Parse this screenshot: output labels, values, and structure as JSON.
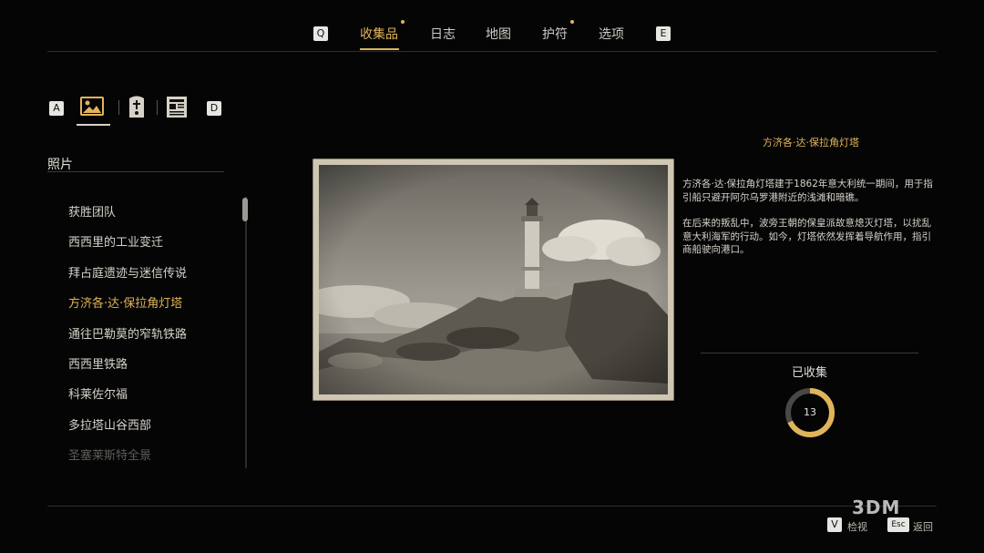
{
  "top_nav": {
    "key_left": "Q",
    "key_right": "E",
    "tabs": [
      {
        "label": "收集品",
        "active": true,
        "dot": true
      },
      {
        "label": "日志",
        "active": false,
        "dot": false
      },
      {
        "label": "地图",
        "active": false,
        "dot": false
      },
      {
        "label": "护符",
        "active": false,
        "dot": true
      },
      {
        "label": "选项",
        "active": false,
        "dot": false
      }
    ]
  },
  "category_bar": {
    "key_left": "A",
    "key_right": "D",
    "icons": [
      "photo-icon",
      "grave-cross-icon",
      "newspaper-icon"
    ],
    "selected": "photo-icon"
  },
  "list": {
    "title": "照片",
    "items": [
      "获胜团队",
      "西西里的工业变迁",
      "拜占庭遗迹与迷信传说",
      "方济各·达·保拉角灯塔",
      "通往巴勒莫的窄轨铁路",
      "西西里铁路",
      "科莱佐尔福",
      "多拉塔山谷西部",
      "圣塞莱斯特全景"
    ],
    "selected_index": 3
  },
  "detail": {
    "title": "方济各·达·保拉角灯塔",
    "paragraph1": "方济各·达·保拉角灯塔建于1862年意大利统一期间，用于指引船只避开阿尔乌罗港附近的浅滩和暗礁。",
    "paragraph2": "在后来的叛乱中，波旁王朝的保皇派故意熄灭灯塔，以扰乱意大利海军的行动。如今，灯塔依然发挥着导航作用，指引商船驶向港口。"
  },
  "collection": {
    "label": "已收集",
    "count": "13",
    "progress": 0.68,
    "accent": "#e0b45a"
  },
  "bottom_hints": {
    "key_v": "V",
    "label_v": "检视",
    "key_esc": "Esc",
    "label_esc": "返回"
  },
  "watermark": "3DM"
}
